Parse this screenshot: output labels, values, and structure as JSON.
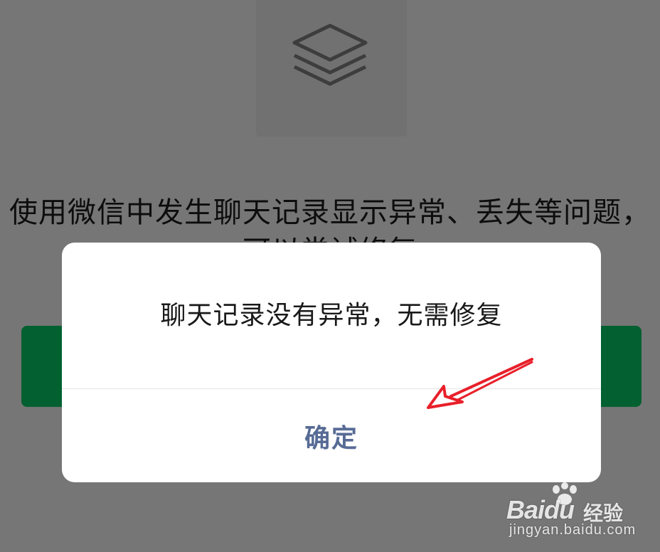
{
  "page": {
    "description_text": "使用微信中发生聊天记录显示异常、丢失等问题，可以尝试修复",
    "stack_icon": "layers-icon"
  },
  "dialog": {
    "message": "聊天记录没有异常，无需修复",
    "confirm_label": "确定"
  },
  "watermark": {
    "brand": "Bai",
    "brand_du": "du",
    "brand_cn": "经验",
    "url": "jingyan.baidu.com"
  },
  "colors": {
    "primary_green": "#07c160",
    "link_blue": "#576b95",
    "annotation_red": "#e8202a"
  }
}
